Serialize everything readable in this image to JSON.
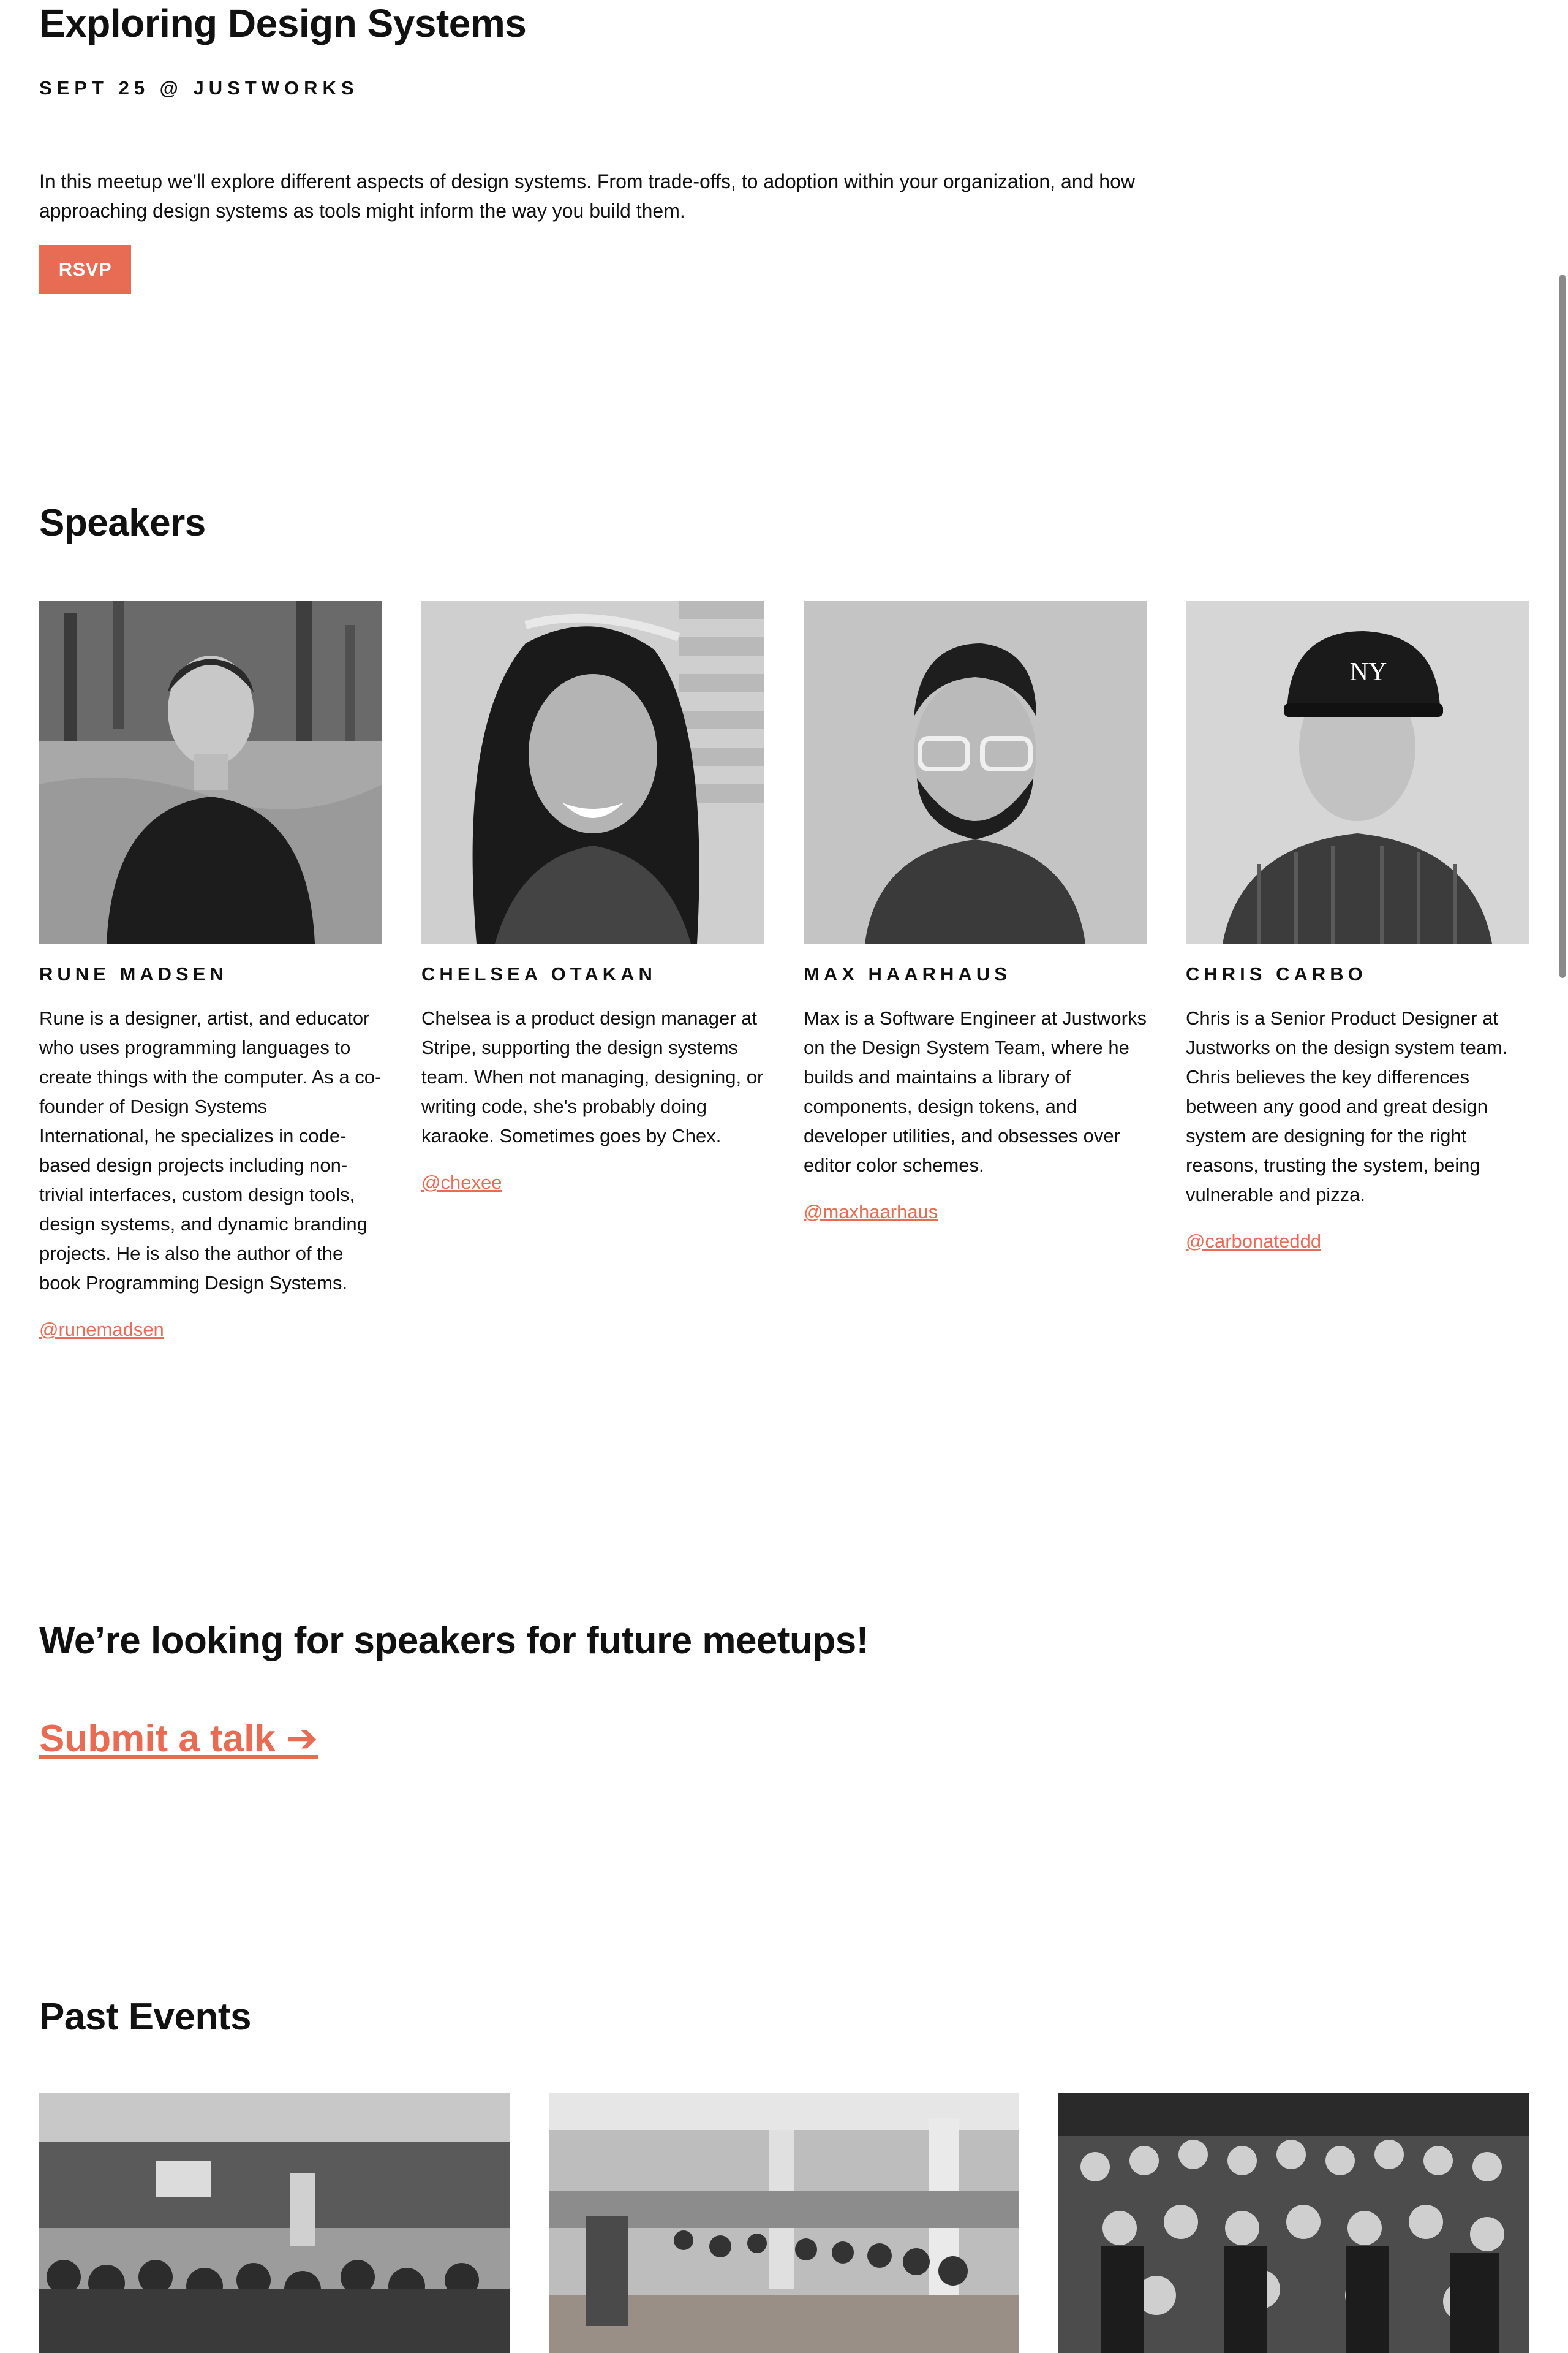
{
  "event": {
    "title": "Exploring Design Systems",
    "date_venue": "SEPT 25 @ JUSTWORKS",
    "description": "In this meetup we'll explore different aspects of design systems. From trade-offs, to adoption within your organization, and how approaching design systems as tools might inform the way you build them.",
    "rsvp_label": "RSVP"
  },
  "speakers_section": {
    "heading": "Speakers",
    "items": [
      {
        "name": "RUNE MADSEN",
        "bio": "Rune is a designer, artist, and educator who uses programming languages to create things with the computer. As a co-founder of Design Systems International, he specializes in code-based design projects including non-trivial interfaces, custom design tools, design systems, and dynamic branding projects. He is also the author of the book Programming Design Systems.",
        "handle": "@runemadsen"
      },
      {
        "name": "CHELSEA OTAKAN",
        "bio": "Chelsea is a product design manager at Stripe, supporting the design systems team. When not managing, designing, or writing code, she's probably doing karaoke. Sometimes goes by Chex.",
        "handle": "@chexee"
      },
      {
        "name": "MAX HAARHAUS",
        "bio": "Max is a Software Engineer at Justworks on the Design System Team, where he builds and maintains a library of components, design tokens, and developer utilities, and obsesses over editor color schemes.",
        "handle": "@maxhaarhaus"
      },
      {
        "name": "CHRIS CARBO",
        "bio": "Chris is a Senior Product Designer at Justworks on the design system team. Chris believes the key differences between any good and great design system are designing for the right reasons, trusting the system, being vulnerable and pizza.",
        "handle": "@carbonateddd"
      }
    ]
  },
  "call_for_speakers": {
    "heading": "We’re looking for speakers for future meetups!",
    "link_label": "Submit a talk ➔"
  },
  "past_events": {
    "heading": "Past Events"
  },
  "colors": {
    "accent": "#e86c54",
    "text": "#111111",
    "background": "#ffffff"
  }
}
